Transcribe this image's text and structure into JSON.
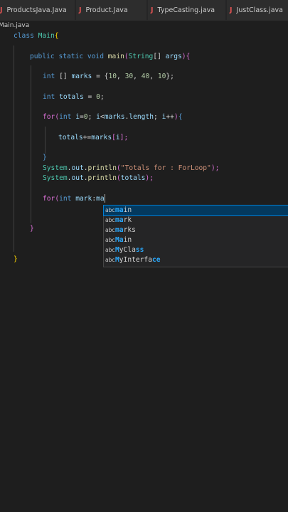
{
  "tabs": [
    {
      "icon": "J",
      "label": "ProductsJava.Java"
    },
    {
      "icon": "J",
      "label": "Product.Java"
    },
    {
      "icon": "J",
      "label": "TypeCasting.java"
    },
    {
      "icon": "J",
      "label": "JustClass.java"
    }
  ],
  "breadcrumb": "Main.java",
  "code": {
    "l1_kw": "class ",
    "l1_name": "Main",
    "l1_brace": "{",
    "l2_public": "public ",
    "l2_static": "static ",
    "l2_void": "void ",
    "l2_main": "main",
    "l2_open": "(",
    "l2_string": "String",
    "l2_arr": "[] ",
    "l2_args": "args",
    "l2_close": ")",
    "l2_brace": "{",
    "l3_int": "int ",
    "l3_arr": "[] ",
    "l3_marks": "marks",
    "l3_eq": " = {",
    "l3_n1": "10",
    "l3_c1": ", ",
    "l3_n2": "30",
    "l3_c2": ", ",
    "l3_n3": "40",
    "l3_c3": ", ",
    "l3_n4": "10",
    "l3_end": "};",
    "l4_int": "int ",
    "l4_totals": "totals",
    "l4_eq": " = ",
    "l4_zero": "0",
    "l4_end": ";",
    "l5_for": "for",
    "l5_open": "(",
    "l5_int": "int ",
    "l5_i": "i",
    "l5_eq": "=",
    "l5_zero": "0",
    "l5_semi": "; ",
    "l5_i2": "i",
    "l5_lt": "<",
    "l5_marks": "marks",
    "l5_dot": ".",
    "l5_length": "length",
    "l5_semi2": "; ",
    "l5_i3": "i",
    "l5_inc": "++",
    "l5_close": ")",
    "l5_brace": "{",
    "l6_totals": "totals",
    "l6_op": "+=",
    "l6_marks": "marks",
    "l6_idx": "[",
    "l6_i": "i",
    "l6_end": "];",
    "l7_brace": "}",
    "l8_system": "System",
    "l8_dot": ".",
    "l8_out": "out",
    "l8_dot2": ".",
    "l8_println": "println",
    "l8_open": "(",
    "l8_str": "\"Totals for : ForLoop\"",
    "l8_close": ");",
    "l9_system": "System",
    "l9_dot": ".",
    "l9_out": "out",
    "l9_dot2": ".",
    "l9_println": "println",
    "l9_open": "(",
    "l9_totals": "totals",
    "l9_close": ");",
    "l10_for": "for",
    "l10_open": "(",
    "l10_int": "int ",
    "l10_mark": "mark",
    "l10_colon": ":",
    "l10_typed": "ma",
    "l11_brace": "}",
    "l12_brace": "}"
  },
  "suggestions": [
    {
      "icon": "abc",
      "label": "main",
      "match": "ma",
      "rest": "in",
      "selected": true
    },
    {
      "icon": "abc",
      "label": "mark",
      "match": "ma",
      "rest": "rk",
      "selected": false
    },
    {
      "icon": "abc",
      "label": "marks",
      "match": "ma",
      "rest": "rks",
      "selected": false
    },
    {
      "icon": "abc",
      "label": "Main",
      "match": "Ma",
      "rest": "in",
      "selected": false
    },
    {
      "icon": "abc",
      "label": "MyClass",
      "pre": "M",
      "match": "yCla",
      "rest": "ss",
      "selected": false
    },
    {
      "icon": "abc",
      "label": "MyInterface",
      "pre": "M",
      "match": "yInterfa",
      "rest": "ce",
      "selected": false
    }
  ],
  "colors": {
    "background": "#1e1e1e",
    "keyword": "#569cd6",
    "type": "#4ec9b0",
    "function": "#dcdcaa",
    "number": "#b5cea8",
    "string": "#ce9178",
    "variable": "#9cdcfe",
    "selection": "#04395e",
    "match": "#2aaaff",
    "java_icon": "#e05252"
  }
}
